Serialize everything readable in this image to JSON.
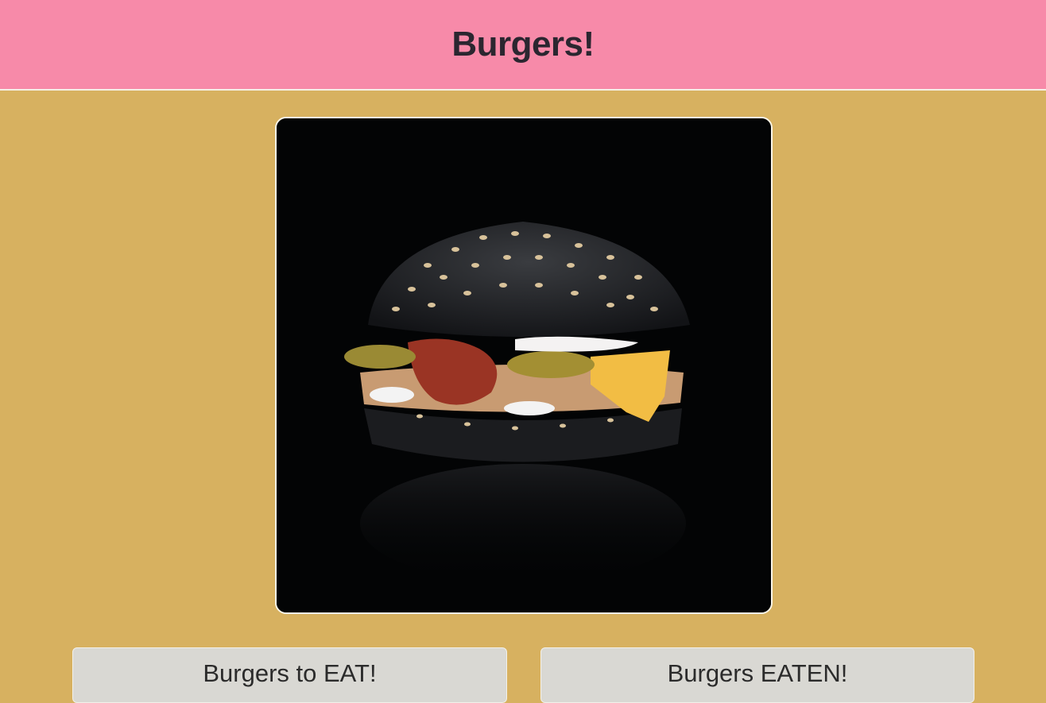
{
  "header": {
    "title": "Burgers!"
  },
  "hero_image": {
    "subject": "black-bun-burger-photo"
  },
  "panels": {
    "to_eat": {
      "title": "Burgers to EAT!"
    },
    "eaten": {
      "title": "Burgers EATEN!"
    }
  },
  "colors": {
    "page_background": "#d7b160",
    "header_background": "#f78aa9",
    "panel_background": "#d9d8d3",
    "text": "#2b2630"
  }
}
